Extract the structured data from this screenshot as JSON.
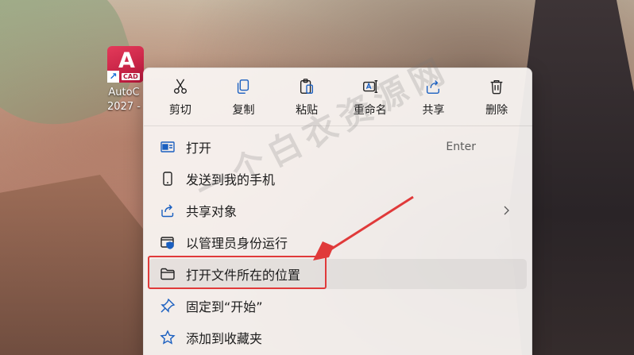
{
  "desktop": {
    "icon": {
      "label_line1": "AutoC",
      "label_line2": "2027 -",
      "tile_letter": "A",
      "tile_badge": "CAD"
    }
  },
  "context_menu": {
    "toolbar": [
      {
        "id": "cut",
        "label": "剪切",
        "icon": "scissors-icon"
      },
      {
        "id": "copy",
        "label": "复制",
        "icon": "copy-icon"
      },
      {
        "id": "paste",
        "label": "粘贴",
        "icon": "paste-icon"
      },
      {
        "id": "rename",
        "label": "重命名",
        "icon": "rename-icon"
      },
      {
        "id": "share",
        "label": "共享",
        "icon": "share-icon"
      },
      {
        "id": "delete",
        "label": "删除",
        "icon": "trash-icon"
      }
    ],
    "items": [
      {
        "id": "open",
        "label": "打开",
        "shortcut": "Enter",
        "icon": "open-window-icon"
      },
      {
        "id": "send-to-phone",
        "label": "发送到我的手机",
        "icon": "phone-icon"
      },
      {
        "id": "share-object",
        "label": "共享对象",
        "icon": "share-out-icon",
        "has_submenu": true
      },
      {
        "id": "run-as-admin",
        "label": "以管理员身份运行",
        "icon": "admin-shield-icon"
      },
      {
        "id": "open-file-location",
        "label": "打开文件所在的位置",
        "icon": "folder-icon",
        "hovered": true
      },
      {
        "id": "pin-to-start",
        "label": "固定到“开始”",
        "icon": "pin-icon"
      },
      {
        "id": "add-to-favorites",
        "label": "添加到收藏夹",
        "icon": "star-icon"
      }
    ]
  },
  "annotation": {
    "highlight_color": "#e03a3a",
    "watermark": "一个白衣资源网"
  }
}
